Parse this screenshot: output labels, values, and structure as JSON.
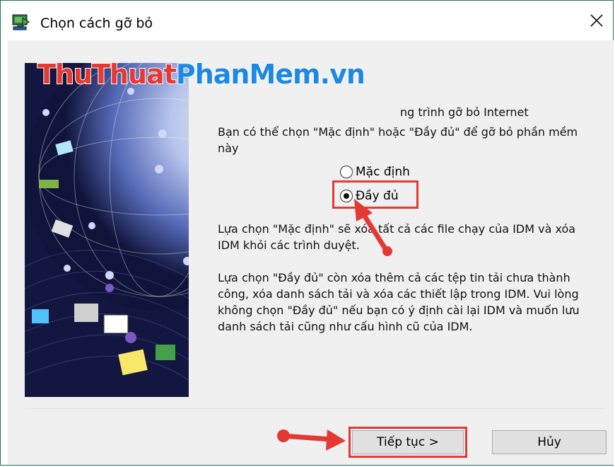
{
  "window": {
    "title": "Chọn cách gỡ bỏ",
    "close_icon": "close-icon"
  },
  "watermark": {
    "part1": "ThuThuat",
    "part2": "PhanMem",
    "part3": ".vn"
  },
  "intro_fragment": "ng trình gỡ bỏ Internet",
  "description": "Bạn có thể chọn \"Mặc định\" hoặc \"Đầy đủ\" để gỡ bỏ phần mềm này",
  "options": [
    {
      "label": "Mặc định",
      "checked": false
    },
    {
      "label": "Đầy đủ",
      "checked": true
    }
  ],
  "default_explanation": "Lựa chọn \"Mặc định\" sẽ xóa tất cả các file chạy của IDM và xóa IDM khỏi các trình duyệt.",
  "full_explanation": "Lựa chọn \"Đầy đủ\" còn xóa thêm cả các tệp tin tải chưa thành công, xóa danh sách tải và xóa các thiết lập trong IDM. Vui lòng không chọn \"Đầy đủ\" nếu bạn có ý định cài lại IDM và muốn lưu danh sách tải cũng như cấu hình cũ của IDM.",
  "buttons": {
    "next": "Tiếp tục >",
    "cancel": "Hủy"
  },
  "colors": {
    "highlight": "#e53935",
    "accent_border": "#1e7b4f"
  }
}
